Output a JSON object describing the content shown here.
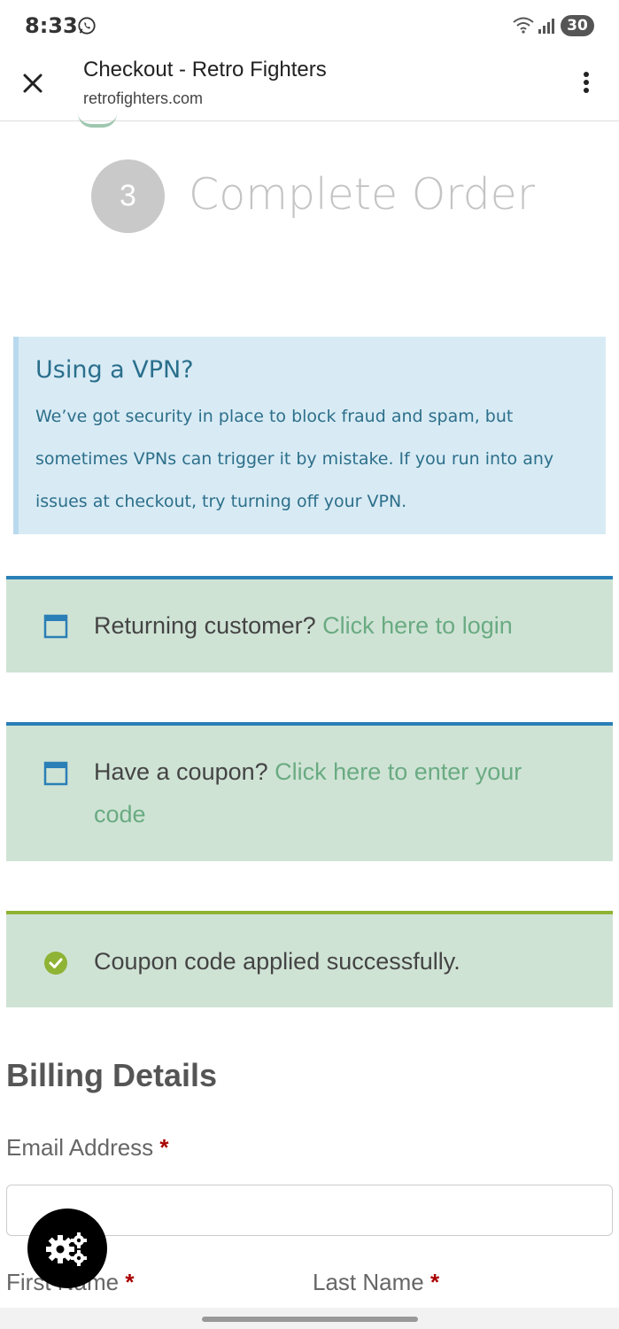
{
  "status_bar": {
    "time": "8:33",
    "battery": "30",
    "icons": [
      "whatsapp-icon",
      "wifi-icon",
      "signal-icon",
      "battery-icon"
    ]
  },
  "browser": {
    "title": "Checkout - Retro Fighters",
    "domain": "retrofighters.com",
    "icons": [
      "close-icon",
      "more-vert-icon"
    ]
  },
  "step": {
    "number": "3",
    "title": "Complete Order"
  },
  "vpn_notice": {
    "heading": "Using a VPN?",
    "body": "We’ve got security in place to block fraud and spam, but sometimes VPNs can trigger it by mistake. If you run into any issues at checkout, try turning off your VPN."
  },
  "notices": {
    "login": {
      "prefix": "Returning customer?",
      "link": "Click here to login"
    },
    "coupon": {
      "prefix": "Have a coupon?",
      "link": "Click here to enter your code"
    },
    "coupon_applied": {
      "message": "Coupon code applied successfully."
    }
  },
  "billing": {
    "heading": "Billing Details",
    "email_label": "Email Address",
    "first_name_label": "First Name",
    "last_name_label": "Last Name",
    "required_mark": "*"
  },
  "colors": {
    "notice_bg": "#cfe3d5",
    "info_border": "#2a7fb6",
    "success_border": "#8fb334",
    "link": "#6aab82",
    "vpn_bg": "#d8ebf5"
  }
}
